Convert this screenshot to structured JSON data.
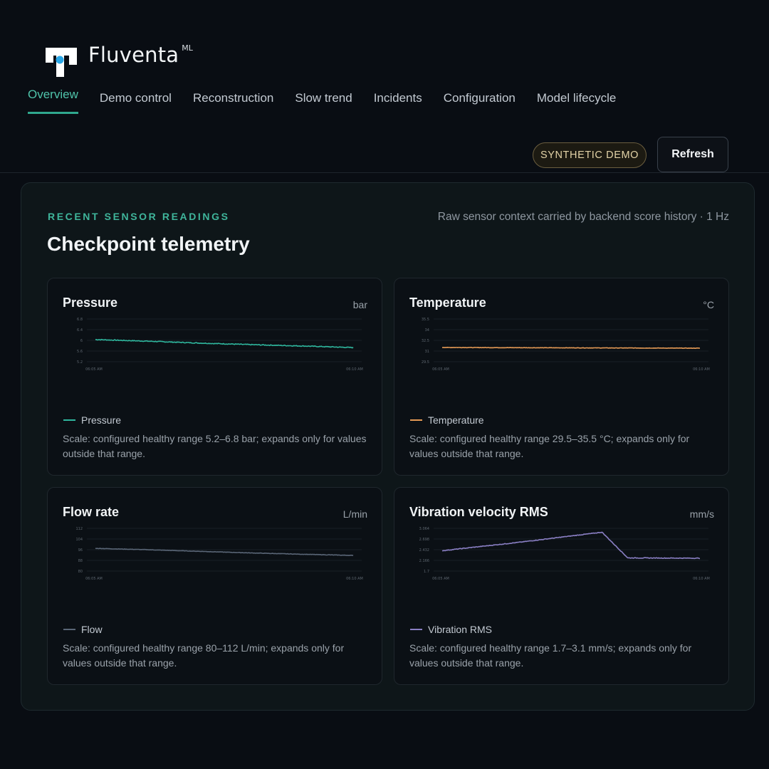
{
  "app": {
    "brand": "Fluventa",
    "brand_sup": "ML",
    "badge": "SYNTHETIC DEMO",
    "refresh_label": "Refresh"
  },
  "nav": {
    "tabs": [
      {
        "label": "Overview",
        "active": true
      },
      {
        "label": "Demo control"
      },
      {
        "label": "Reconstruction"
      },
      {
        "label": "Slow trend"
      },
      {
        "label": "Incidents"
      },
      {
        "label": "Configuration"
      },
      {
        "label": "Model lifecycle"
      }
    ]
  },
  "panel": {
    "eyebrow": "RECENT SENSOR READINGS",
    "title": "Checkpoint telemetry",
    "subtext": "Raw sensor context carried by backend score history · 1 Hz"
  },
  "cards": [
    {
      "title": "Pressure",
      "unit": "bar",
      "legend": "Pressure",
      "color": "#2fb79e",
      "note": "Scale: configured healthy range 5.2–6.8 bar; expands only for values outside that range.",
      "chart_data": {
        "type": "line",
        "series_name": "Pressure",
        "ylim": [
          5.2,
          6.8
        ],
        "yticks": [
          "6.8",
          "6.4",
          "6",
          "5.6",
          "5.2"
        ],
        "xticks": [
          "06:05 AM",
          "06:10 AM"
        ],
        "x": [
          0,
          0.2,
          0.4,
          0.6,
          0.8,
          1
        ],
        "y": [
          6.03,
          5.97,
          5.9,
          5.84,
          5.79,
          5.73
        ],
        "noise": 0.015
      }
    },
    {
      "title": "Temperature",
      "unit": "°C",
      "legend": "Temperature",
      "color": "#e59a55",
      "note": "Scale: configured healthy range 29.5–35.5 °C; expands only for values outside that range.",
      "chart_data": {
        "type": "line",
        "series_name": "Temperature",
        "ylim": [
          29.5,
          35.5
        ],
        "yticks": [
          "35.5",
          "34",
          "32.5",
          "31",
          "29.5"
        ],
        "xticks": [
          "06:05 AM",
          "06:10 AM"
        ],
        "x": [
          0,
          0.5,
          1
        ],
        "y": [
          31.5,
          31.45,
          31.4
        ],
        "noise": 0.025
      }
    },
    {
      "title": "Flow rate",
      "unit": "L/min",
      "legend": "Flow",
      "color": "#5a6677",
      "note": "Scale: configured healthy range 80–112 L/min; expands only for values outside that range.",
      "chart_data": {
        "type": "line",
        "series_name": "Flow",
        "ylim": [
          80,
          112
        ],
        "yticks": [
          "112",
          "104",
          "96",
          "88",
          "80"
        ],
        "xticks": [
          "06:05 AM",
          "06:10 AM"
        ],
        "x": [
          0,
          0.2,
          0.4,
          0.6,
          0.8,
          1
        ],
        "y": [
          97,
          96,
          94.8,
          93.6,
          92.6,
          91.7
        ],
        "noise": 0.15
      }
    },
    {
      "title": "Vibration velocity RMS",
      "unit": "mm/s",
      "legend": "Vibration RMS",
      "color": "#8a7fc4",
      "note": "Scale: configured healthy range 1.7–3.1 mm/s; expands only for values outside that range.",
      "chart_data": {
        "type": "line",
        "series_name": "Vibration RMS",
        "ylim": [
          1.7,
          3.064
        ],
        "yticks": [
          "3.064",
          "2.698",
          "2.432",
          "2.166",
          "1.7"
        ],
        "xticks": [
          "06:05 AM",
          "06:10 AM"
        ],
        "x": [
          0,
          0.3,
          0.62,
          0.72,
          1
        ],
        "y": [
          2.35,
          2.62,
          2.94,
          2.12,
          2.11
        ],
        "noise": 0.01
      }
    }
  ]
}
